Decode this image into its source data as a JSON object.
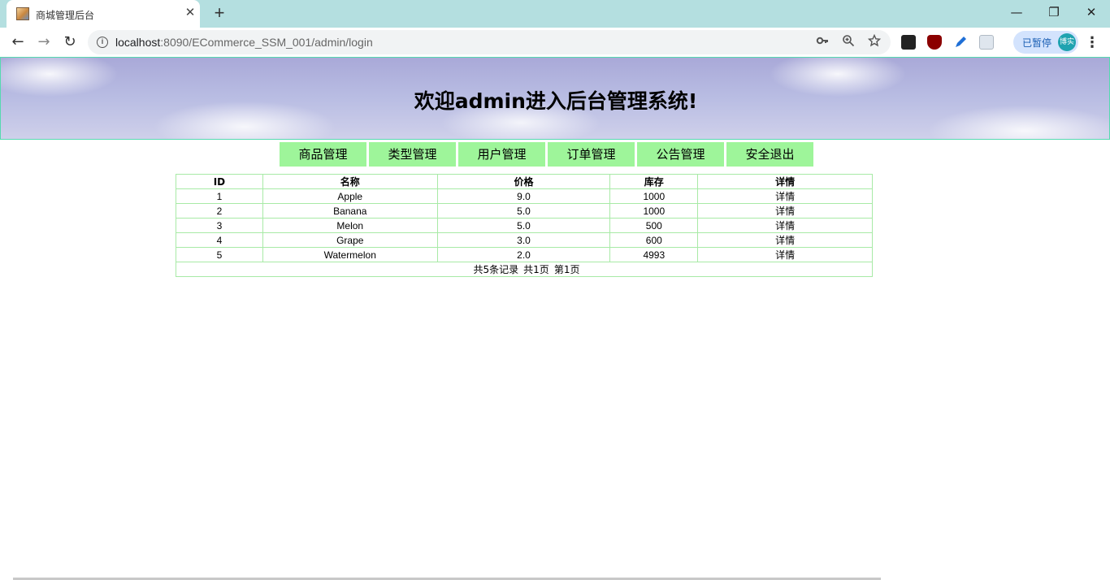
{
  "browser": {
    "tab_title": "商城管理后台",
    "tab_close": "✕",
    "new_tab": "+",
    "window_controls": {
      "minimize": "—",
      "restore": "❐",
      "close": "✕"
    },
    "nav": {
      "back": "←",
      "forward": "→",
      "reload": "↻"
    },
    "url_host": "localhost",
    "url_rest": ":8090/ECommerce_SSM_001/admin/login",
    "profile_label": "已暂停",
    "profile_avatar": "博实",
    "icons": [
      "info-icon",
      "key-icon",
      "zoom-icon",
      "star-icon",
      "tab-extension-icon",
      "ublock-icon",
      "pen-icon",
      "reader-icon",
      "menu-icon"
    ]
  },
  "header": {
    "title": "欢迎admin进入后台管理系统!"
  },
  "menu": {
    "items": [
      "商品管理",
      "类型管理",
      "用户管理",
      "订单管理",
      "公告管理",
      "安全退出"
    ]
  },
  "table": {
    "headers": [
      "ID",
      "名称",
      "价格",
      "库存",
      "详情"
    ],
    "rows": [
      [
        "1",
        "Apple",
        "9.0",
        "1000",
        "详情"
      ],
      [
        "2",
        "Banana",
        "5.0",
        "1000",
        "详情"
      ],
      [
        "3",
        "Melon",
        "5.0",
        "500",
        "详情"
      ],
      [
        "4",
        "Grape",
        "3.0",
        "600",
        "详情"
      ],
      [
        "5",
        "Watermelon",
        "2.0",
        "4993",
        "详情"
      ]
    ],
    "pager": {
      "total_records": "共5条记录",
      "total_pages": "共1页",
      "current_page": "第1页"
    }
  },
  "colors": {
    "tabstrip": "#b4dfe0",
    "menu_bg": "#9ef59a",
    "table_border": "#a8eaa6",
    "banner_border": "#56d9b0"
  }
}
